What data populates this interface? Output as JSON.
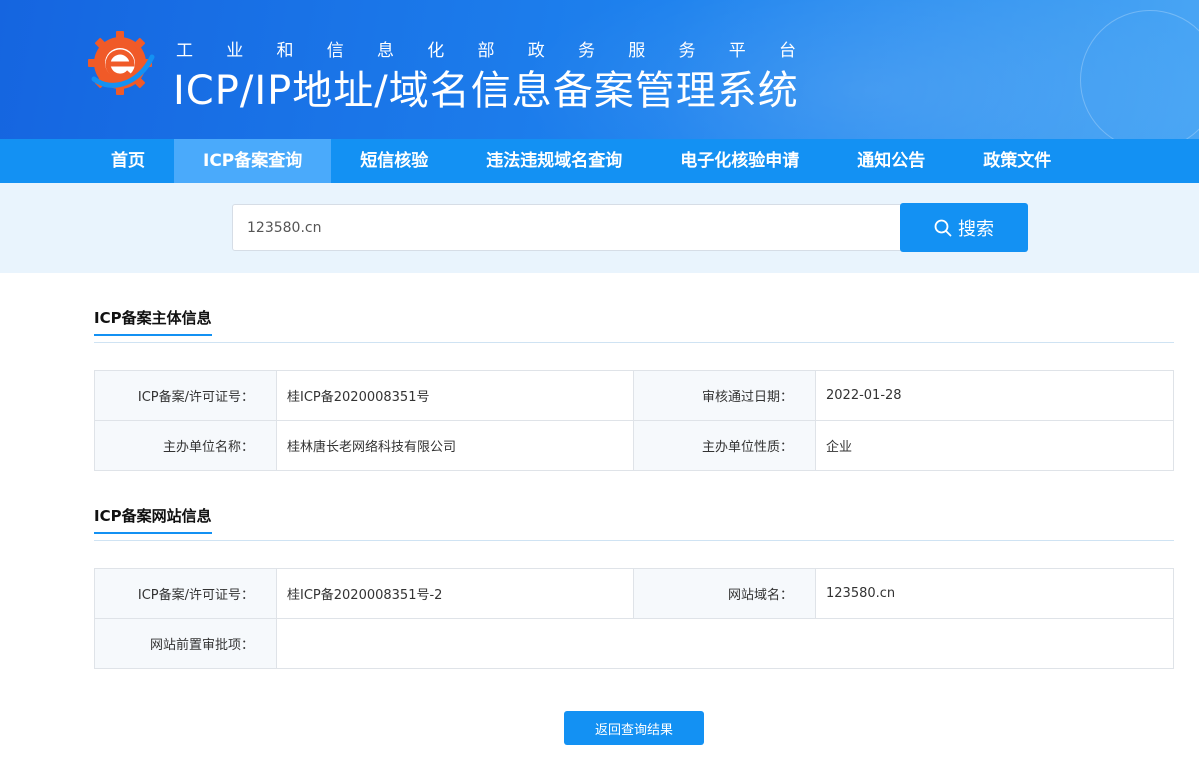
{
  "header": {
    "slogan_chars": [
      "工",
      "业",
      "和",
      "信",
      "息",
      "化",
      "部",
      "政",
      "务",
      "服",
      "务",
      "平",
      "台"
    ],
    "system_title": "ICP/IP地址/域名信息备案管理系统",
    "logo_icon": "gear-e-logo-icon"
  },
  "nav": {
    "items": [
      {
        "label": "首页",
        "active": false
      },
      {
        "label": "ICP备案查询",
        "active": true
      },
      {
        "label": "短信核验",
        "active": false
      },
      {
        "label": "违法违规域名查询",
        "active": false
      },
      {
        "label": "电子化核验申请",
        "active": false
      },
      {
        "label": "通知公告",
        "active": false
      },
      {
        "label": "政策文件",
        "active": false
      }
    ]
  },
  "search": {
    "value": "123580.cn",
    "button_label": "搜索",
    "button_icon": "search-icon"
  },
  "subject_section": {
    "title": "ICP备案主体信息",
    "rows": [
      [
        {
          "label": "ICP备案/许可证号：",
          "value": "桂ICP备2020008351号"
        },
        {
          "label": "审核通过日期：",
          "value": "2022-01-28"
        }
      ],
      [
        {
          "label": "主办单位名称：",
          "value": "桂林唐长老网络科技有限公司"
        },
        {
          "label": "主办单位性质：",
          "value": "企业"
        }
      ]
    ]
  },
  "website_section": {
    "title": "ICP备案网站信息",
    "row1": [
      {
        "label": "ICP备案/许可证号：",
        "value": "桂ICP备2020008351号-2"
      },
      {
        "label": "网站域名：",
        "value": "123580.cn"
      }
    ],
    "row2": {
      "label": "网站前置审批项：",
      "value": ""
    }
  },
  "back_button_label": "返回查询结果",
  "colors": {
    "primary": "#1391f3",
    "nav_active": "#4aaafb",
    "search_band": "#e9f4fd",
    "logo_orange": "#f05a28"
  }
}
